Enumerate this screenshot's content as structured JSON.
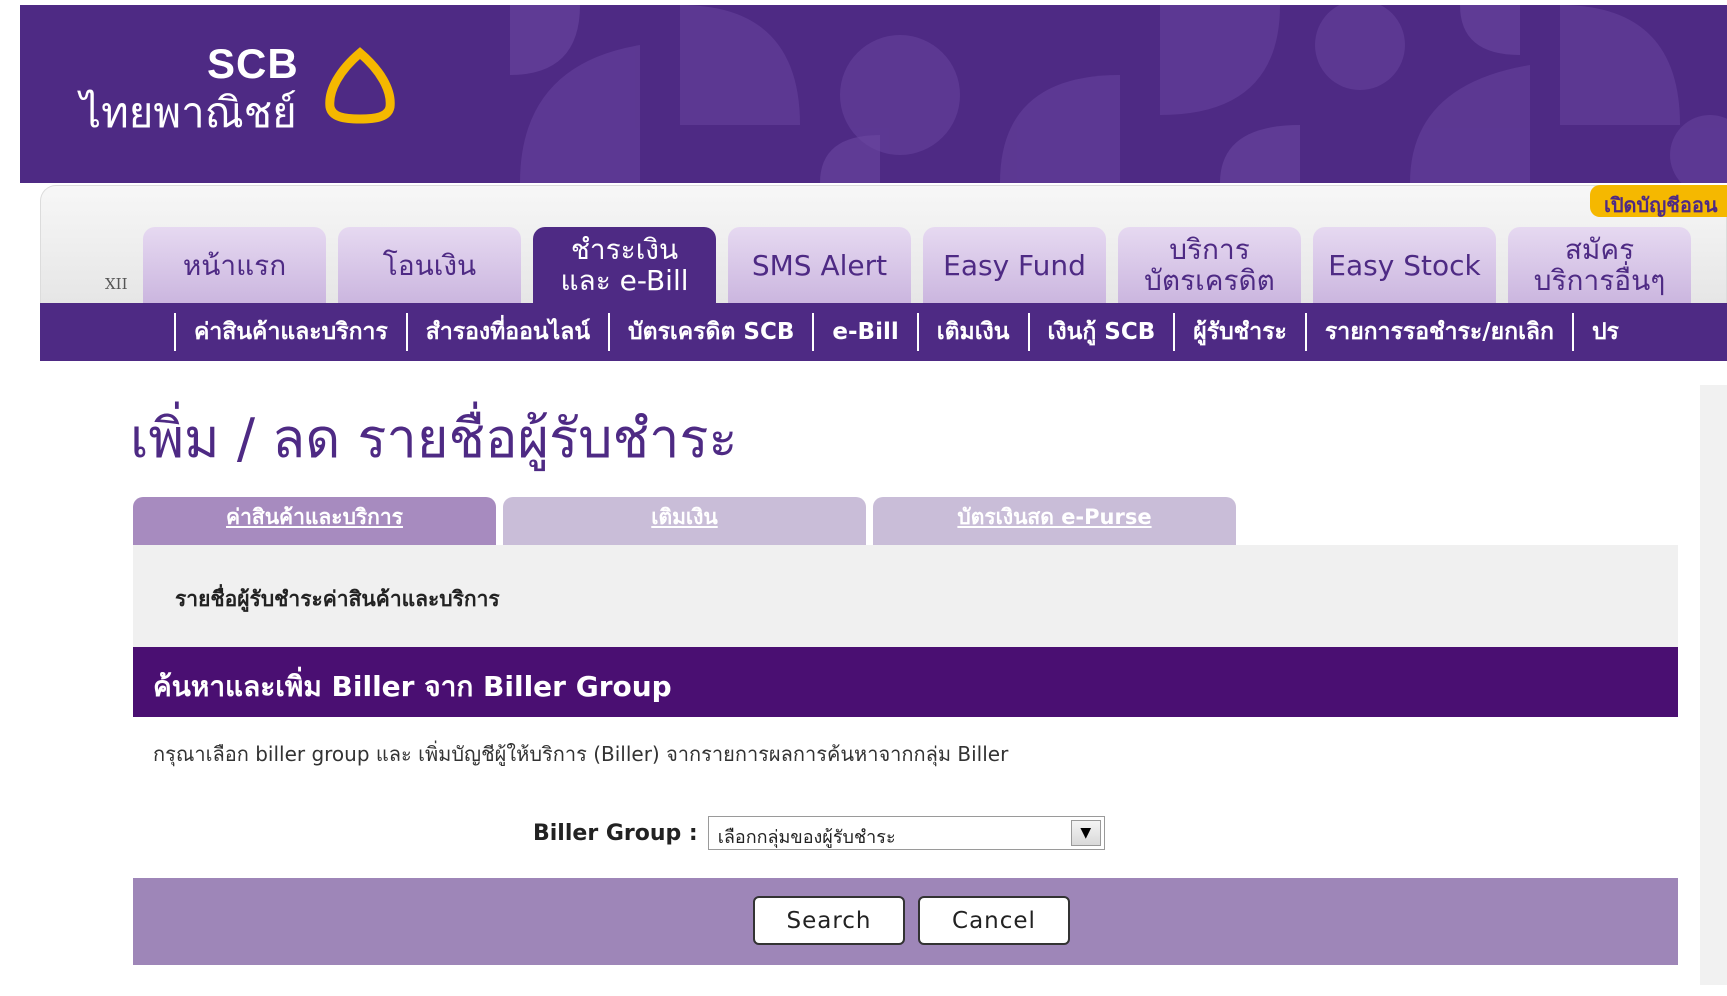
{
  "brand": {
    "name_en": "SCB",
    "name_th": "ไทยพาณิชย์"
  },
  "header": {
    "open_account": "เปิดบัญชีออน",
    "small_mark": "XII"
  },
  "main_tabs": [
    {
      "label": "หน้าแรก",
      "active": false
    },
    {
      "label": "โอนเงิน",
      "active": false
    },
    {
      "label": "ชำระเงิน\nและ e-Bill",
      "active": true
    },
    {
      "label": "SMS Alert",
      "active": false
    },
    {
      "label": "Easy Fund",
      "active": false
    },
    {
      "label": "บริการ\nบัตรเครดิต",
      "active": false
    },
    {
      "label": "Easy Stock",
      "active": false
    },
    {
      "label": "สมัคร\nบริการอื่นๆ",
      "active": false
    }
  ],
  "sub_nav": [
    "ค่าสินค้าและบริการ",
    "สำรองที่ออนไลน์",
    "บัตรเครดิต SCB",
    "e-Bill",
    "เติมเงิน",
    "เงินกู้ SCB",
    "ผู้รับชำระ",
    "รายการรอชำระ/ยกเลิก",
    "ปร"
  ],
  "page_title": "เพิ่ม / ลด รายชื่อผู้รับชำระ",
  "content_tabs": [
    {
      "label": "ค่าสินค้าและบริการ",
      "active": true
    },
    {
      "label": "เติมเงิน",
      "active": false
    },
    {
      "label": "บัตรเงินสด e-Purse",
      "active": false
    }
  ],
  "list_label": "รายชื่อผู้รับชำระค่าสินค้าและบริการ",
  "section_header": "ค้นหาและเพิ่ม Biller จาก Biller Group",
  "instruction": "กรุณาเลือก biller group และ เพิ่มบัญชีผู้ให้บริการ (Biller) จากรายการผลการค้นหาจากกลุ่ม Biller",
  "biller_group": {
    "label": "Biller Group :",
    "selected": "เลือกกลุ่มของผู้รับชำระ"
  },
  "buttons": {
    "search": "Search",
    "cancel": "Cancel"
  },
  "colors": {
    "brand_purple": "#4e2a84",
    "section_purple": "#4a0f72",
    "accent_gold": "#f5b800",
    "button_bar": "#9e86b8"
  }
}
